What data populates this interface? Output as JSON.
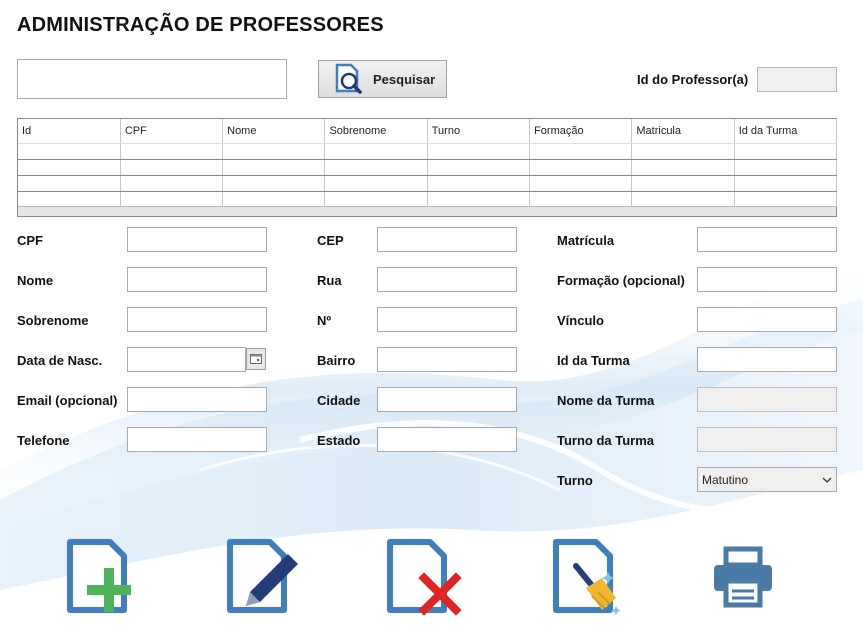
{
  "header": {
    "title": "ADMINISTRAÇÃO DE PROFESSORES"
  },
  "search": {
    "value": "",
    "button_label": "Pesquisar"
  },
  "id_professor": {
    "label": "Id do Professor(a)",
    "value": ""
  },
  "grid": {
    "columns": [
      "Id",
      "CPF",
      "Nome",
      "Sobrenome",
      "Turno",
      "Formação",
      "Matricula",
      "Id da Turma"
    ],
    "rows": [
      [
        "",
        "",
        "",
        "",
        "",
        "",
        "",
        ""
      ],
      [
        "",
        "",
        "",
        "",
        "",
        "",
        "",
        ""
      ],
      [
        "",
        "",
        "",
        "",
        "",
        "",
        "",
        ""
      ],
      [
        "",
        "",
        "",
        "",
        "",
        "",
        "",
        ""
      ]
    ]
  },
  "form": {
    "col1": [
      {
        "label": "CPF",
        "value": ""
      },
      {
        "label": "Nome",
        "value": ""
      },
      {
        "label": "Sobrenome",
        "value": ""
      },
      {
        "label": "Data de Nasc.",
        "value": ""
      },
      {
        "label": "Email (opcional)",
        "value": ""
      },
      {
        "label": "Telefone",
        "value": ""
      }
    ],
    "col2": [
      {
        "label": "CEP",
        "value": ""
      },
      {
        "label": "Rua",
        "value": ""
      },
      {
        "label": "Nº",
        "value": ""
      },
      {
        "label": "Bairro",
        "value": ""
      },
      {
        "label": "Cidade",
        "value": ""
      },
      {
        "label": "Estado",
        "value": ""
      }
    ],
    "col3": [
      {
        "label": "Matrícula",
        "value": ""
      },
      {
        "label": "Formação (opcional)",
        "value": ""
      },
      {
        "label": "Vínculo",
        "value": ""
      },
      {
        "label": "Id da Turma",
        "value": ""
      },
      {
        "label": "Nome da Turma",
        "value": ""
      },
      {
        "label": "Turno da Turma",
        "value": ""
      }
    ],
    "turno": {
      "label": "Turno",
      "selected": "Matutino"
    }
  },
  "actions": [
    {
      "name": "add-document-icon"
    },
    {
      "name": "edit-document-icon"
    },
    {
      "name": "delete-document-icon"
    },
    {
      "name": "clear-document-icon"
    },
    {
      "name": "printer-icon"
    }
  ],
  "colors": {
    "icon_blue": "#3f7fc0",
    "add_green": "#4cb55a",
    "delete_red": "#e02424",
    "pen_navy": "#233c7a"
  }
}
